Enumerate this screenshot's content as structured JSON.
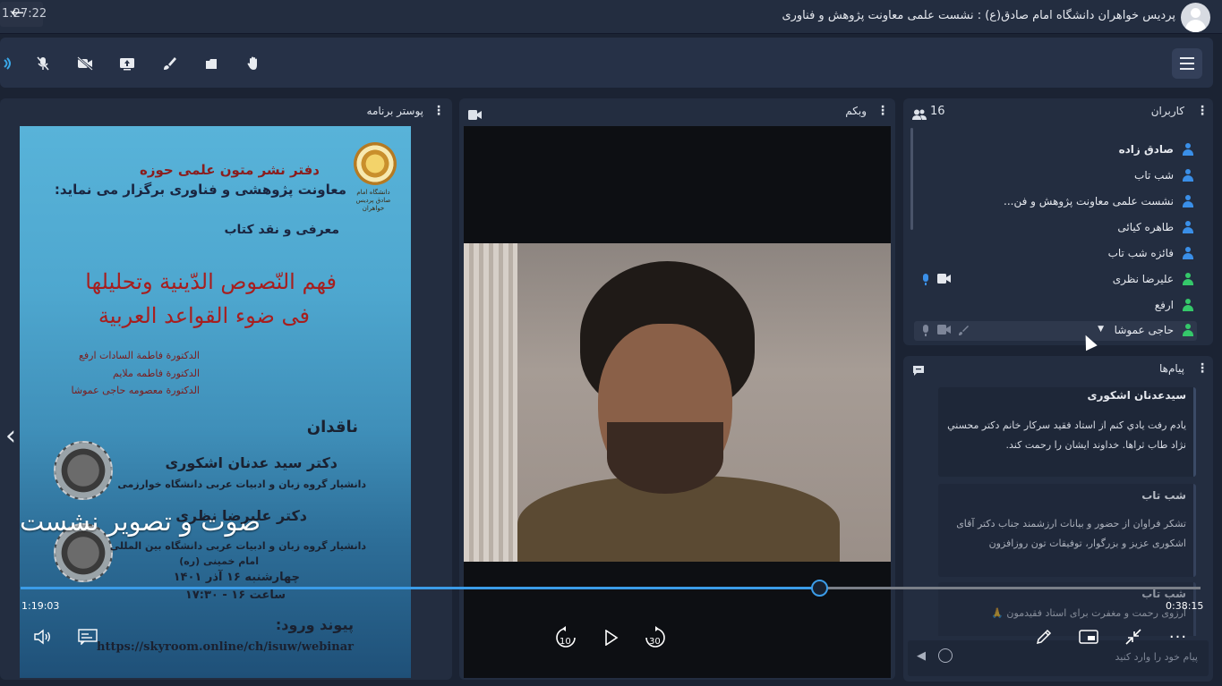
{
  "header": {
    "clock": "1:27:22",
    "title": "پردیس خواهران دانشگاه امام صادق(ع) : نشست علمی معاونت پژوهش و فناوری"
  },
  "toolbar": {
    "buttons": [
      {
        "name": "speaker-icon"
      },
      {
        "name": "mic-off-icon"
      },
      {
        "name": "camera-off-icon"
      },
      {
        "name": "screen-share-icon"
      },
      {
        "name": "brush-icon"
      },
      {
        "name": "files-icon"
      },
      {
        "name": "raise-hand-icon"
      }
    ],
    "menu_icon": "menu-icon"
  },
  "poster_panel": {
    "title": "پوستر برنامه",
    "poster": {
      "logo_text": "دانشگاه امام صادق پردیس خواهران",
      "line1": "دفتر نشر متون علمی حوزه",
      "line2": "معاونت پژوهشی و فناوری برگزار می نماید:",
      "line3": "معرفی و نقد کتاب",
      "book_title_1": "فهم النّصوص الدّینیة وتحلیلها",
      "book_title_2": "فی ضوء القواعد العربیة",
      "authors": [
        "الدکتورة فاطمة السادات ارفع",
        "الدکتورة فاطمه ملایم",
        "الدکتورة معصومه حاجی عموشا"
      ],
      "critics_label": "ناقدان",
      "critic1_name": "دکتر سید عدنان اشکوری",
      "critic1_role": "دانشیار گروه زبان و ادبیات عربی دانشگاه خوارزمی",
      "critic2_name": "دکتر علیرضا نظری",
      "critic2_role": "دانشیار گروه زبان و ادبیات عربی دانشگاه بین المللی",
      "critic2_role2": "امام خمینی (ره)",
      "date": "چهارشنبه ۱۶ آذر ۱۴۰۱",
      "time": "ساعت ۱۶ - ۱۷:۳۰",
      "link_label": "پیوند ورود:",
      "link": "https://skyroom.online/ch/isuw/webinar"
    }
  },
  "webcam_panel": {
    "title": "وبکم"
  },
  "users_panel": {
    "title": "کاربران",
    "count": "16",
    "users": [
      {
        "name": "صادق زاده",
        "role": "blue",
        "bold": true
      },
      {
        "name": "شب تاب",
        "role": "blue"
      },
      {
        "name": "نشست علمی معاونت پژوهش و فن...",
        "role": "blue"
      },
      {
        "name": "طاهره کیائی",
        "role": "blue"
      },
      {
        "name": "فائزه شب تاب",
        "role": "blue"
      },
      {
        "name": "علیرضا نظری",
        "role": "green",
        "media": true
      },
      {
        "name": "ارفع",
        "role": "green"
      },
      {
        "name": "حاجی عموشا",
        "role": "green",
        "selected": true
      }
    ]
  },
  "chat_panel": {
    "title": "پیام‌ها",
    "messages": [
      {
        "sender": "سیدعدنان اشکوری",
        "text": "یادم رفت یادي کنم از استاد فقید سرکار خانم دکتر محسني نژاد طاب ثراها. خداوند ایشان را رحمت کند."
      },
      {
        "sender": "شب تاب",
        "text": "تشکر فراوان از  حضور و بیانات ارزشمند جناب دکتر آقای اشکوری عزیز و بزرگوار، توفیقات تون روزافزون"
      },
      {
        "sender": "شب تاب",
        "text": "آرزوی رحمت و مغفرت برای استاد فقیدمون 🙏"
      }
    ],
    "input_placeholder": "پیام خود را وارد کنید"
  },
  "player": {
    "caption": "صوت و تصویر نشست",
    "elapsed": "1:19:03",
    "remaining": "0:38:15",
    "progress": 0.677,
    "skip_back": "10",
    "skip_forward": "30"
  }
}
